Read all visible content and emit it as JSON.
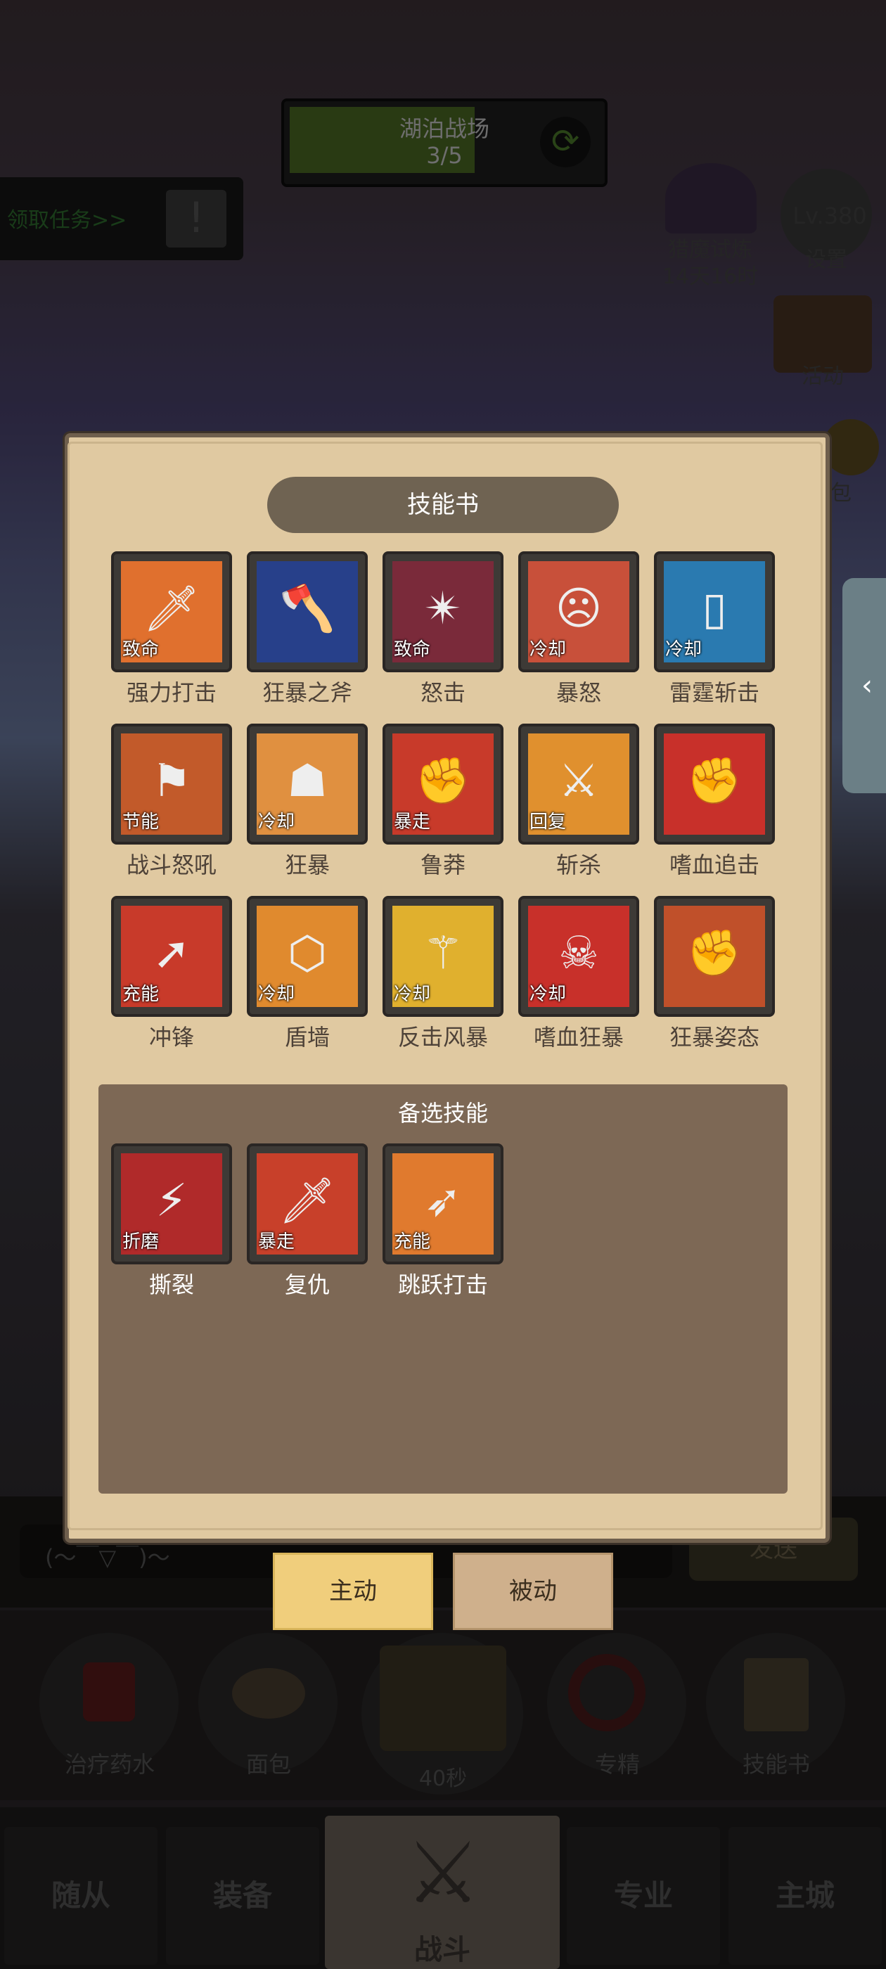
{
  "hud": {
    "stage_title": "湖泊战场",
    "stage_progress": "3/5",
    "stage_progress_fraction": 0.6,
    "task_link": "领取任务>>",
    "demon_trial": "猎魔试炼",
    "demon_time": "14天16时",
    "level": "Lv.380",
    "settings": "设置",
    "activity": "活动",
    "pack": "包"
  },
  "dialog": {
    "title": "技能书",
    "skills": [
      {
        "name": "强力打击",
        "tag": "致命",
        "icon": "sword-strike-icon",
        "bg": "#e0702e"
      },
      {
        "name": "狂暴之斧",
        "tag": "",
        "icon": "lightning-axe-icon",
        "bg": "#27408a"
      },
      {
        "name": "怒击",
        "tag": "致命",
        "icon": "rage-strike-icon",
        "bg": "#7a2a3a"
      },
      {
        "name": "暴怒",
        "tag": "冷却",
        "icon": "roaring-face-icon",
        "bg": "#c8503a"
      },
      {
        "name": "雷霆斩击",
        "tag": "冷却",
        "icon": "thunder-slash-icon",
        "bg": "#2a7ab0"
      },
      {
        "name": "战斗怒吼",
        "tag": "节能",
        "icon": "battle-cry-icon",
        "bg": "#c25a2a"
      },
      {
        "name": "狂暴",
        "tag": "冷却",
        "icon": "berserk-hood-icon",
        "bg": "#e09040"
      },
      {
        "name": "鲁莽",
        "tag": "暴走",
        "icon": "reckless-fist-icon",
        "bg": "#c83a2a"
      },
      {
        "name": "斩杀",
        "tag": "回复",
        "icon": "execute-sword-icon",
        "bg": "#e0902e"
      },
      {
        "name": "嗜血追击",
        "tag": "",
        "icon": "bloodthirst-fist-icon",
        "bg": "#c8302a"
      },
      {
        "name": "冲锋",
        "tag": "充能",
        "icon": "charge-arrow-icon",
        "bg": "#c83a2a"
      },
      {
        "name": "盾墙",
        "tag": "冷却",
        "icon": "shield-wall-icon",
        "bg": "#e08a2e"
      },
      {
        "name": "反击风暴",
        "tag": "冷却",
        "icon": "counter-storm-icon",
        "bg": "#e0b02e"
      },
      {
        "name": "嗜血狂暴",
        "tag": "冷却",
        "icon": "blood-rage-mask-icon",
        "bg": "#c8302a"
      },
      {
        "name": "狂暴姿态",
        "tag": "",
        "icon": "golden-fist-icon",
        "bg": "#c0502a"
      }
    ],
    "backup_title": "备选技能",
    "backup_skills": [
      {
        "name": "撕裂",
        "tag": "折磨",
        "icon": "rend-claw-icon",
        "bg": "#b02a2a"
      },
      {
        "name": "复仇",
        "tag": "暴走",
        "icon": "revenge-sword-icon",
        "bg": "#c8402a"
      },
      {
        "name": "跳跃打击",
        "tag": "充能",
        "icon": "leap-strike-icon",
        "bg": "#e07a2e"
      }
    ]
  },
  "modes": {
    "active": "主动",
    "passive": "被动"
  },
  "chat": {
    "placeholder": "(～￣▽￣)～",
    "send": "发送"
  },
  "consumables": {
    "potion": "治疗药水",
    "bread": "面包",
    "chest_timer": "40秒",
    "specialty": "专精",
    "skill_book": "技能书"
  },
  "nav": {
    "followers": "随从",
    "equipment": "装备",
    "battle": "战斗",
    "profession": "专业",
    "city": "主城"
  }
}
